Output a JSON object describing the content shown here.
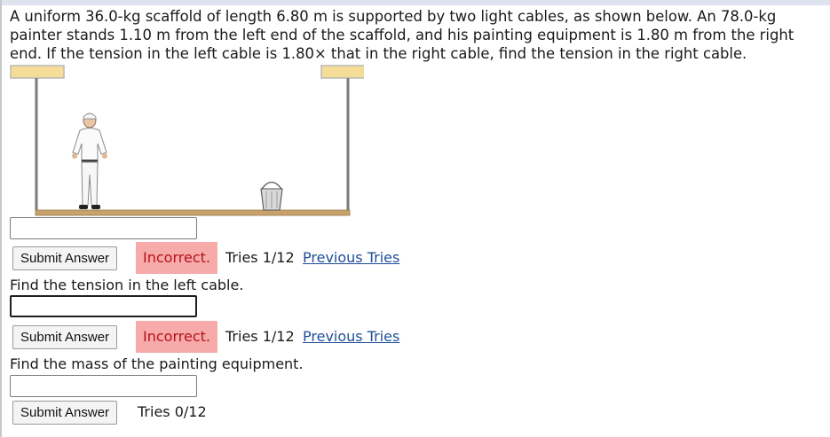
{
  "problem": {
    "text": "A uniform 36.0-kg scaffold of length 6.80 m is supported by two light cables, as shown below. An 78.0-kg painter stands 1.10 m from the left end of the scaffold, and his painting equipment is 1.80 m from the right end. If the tension in the left cable is 1.80× that in the right cable, find the tension in the right cable."
  },
  "parts": [
    {
      "prompt": "",
      "input_value": "",
      "submit_label": "Submit Answer",
      "status": "Incorrect.",
      "tries": "Tries 1/12",
      "previous_tries_label": "Previous Tries"
    },
    {
      "prompt": "Find the tension in the left cable.",
      "input_value": "",
      "submit_label": "Submit Answer",
      "status": "Incorrect.",
      "tries": "Tries 1/12",
      "previous_tries_label": "Previous Tries"
    },
    {
      "prompt": "Find the mass of the painting equipment.",
      "input_value": "",
      "submit_label": "Submit Answer",
      "status": "",
      "tries": "Tries 0/12",
      "previous_tries_label": ""
    }
  ],
  "colors": {
    "status_incorrect_bg": "#f7aaaa",
    "status_incorrect_text": "#b5111b",
    "link": "#1f4e9a",
    "ceiling_mount": "#f6dd97",
    "plank": "#c8a26c",
    "cable": "#7a7a7a"
  }
}
